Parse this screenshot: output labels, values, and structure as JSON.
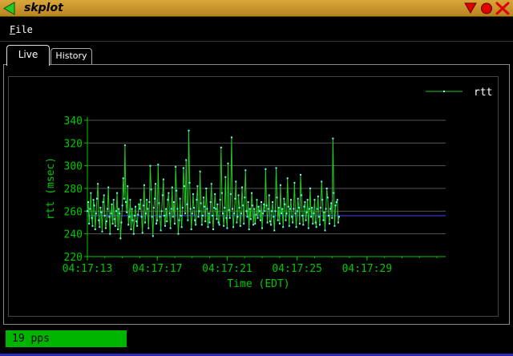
{
  "window": {
    "title": "skplot"
  },
  "menu": {
    "file_label": "File",
    "file_mnemonic": "F",
    "file_rest": "ile"
  },
  "tabs": [
    {
      "label": "Live",
      "active": true
    },
    {
      "label": "History",
      "active": false
    }
  ],
  "status": {
    "rate": "19 pps"
  },
  "colors": {
    "line": "#22cc22",
    "marker": "#66ffff",
    "mean": "#4444ff",
    "axis": "#00c800",
    "grid": "#555555",
    "titlebar": "#c8962c",
    "status": "#00b400"
  },
  "chart_data": {
    "type": "line",
    "xlabel": "Time (EDT)",
    "ylabel": "rtt (msec)",
    "ylim": [
      220,
      340
    ],
    "yticks": [
      220,
      240,
      260,
      280,
      300,
      320,
      340
    ],
    "xticks": [
      "04:17:13",
      "04:17:17",
      "04:17:21",
      "04:17:25",
      "04:17:29"
    ],
    "xlim_seconds": [
      13,
      33.5
    ],
    "mean_line": 256,
    "grid": true,
    "legend": {
      "position": "top-right",
      "entries": [
        "rtt"
      ]
    },
    "series": [
      {
        "name": "rtt",
        "x_step_seconds": 0.05,
        "x_start_seconds": 13,
        "values": [
          260,
          268,
          249,
          262,
          276,
          254,
          247,
          270,
          265,
          244,
          258,
          271,
          284,
          252,
          246,
          263,
          259,
          242,
          268,
          274,
          256,
          245,
          251,
          262,
          281,
          255,
          240,
          258,
          266,
          249,
          270,
          253,
          247,
          260,
          276,
          244,
          262,
          258,
          236,
          250,
          265,
          289,
          271,
          318,
          268,
          259,
          282,
          248,
          255,
          270,
          244,
          262,
          252,
          240,
          256,
          264,
          251,
          247,
          257,
          266,
          262,
          270,
          255,
          241,
          265,
          283,
          250,
          258,
          270,
          262,
          245,
          268,
          300,
          279,
          255,
          238,
          263,
          271,
          284,
          249,
          252,
          301,
          267,
          255,
          243,
          260,
          274,
          288,
          256,
          247,
          262,
          251,
          270,
          276,
          258,
          245,
          262,
          281,
          255,
          268,
          249,
          299,
          278,
          262,
          240,
          252,
          271,
          256,
          246,
          263,
          298,
          282,
          258,
          305,
          266,
          252,
          331,
          285,
          262,
          244,
          258,
          275,
          263,
          252,
          248,
          270,
          282,
          255,
          260,
          295,
          267,
          248,
          256,
          272,
          264,
          251,
          280,
          262,
          246,
          258,
          250,
          268,
          284,
          256,
          244,
          263,
          275,
          262,
          253,
          266,
          250,
          248,
          270,
          316,
          276,
          258,
          247,
          263,
          290,
          254,
          245,
          302,
          261,
          254,
          275,
          325,
          262,
          246,
          258,
          271,
          286,
          250,
          255,
          274,
          263,
          247,
          258,
          281,
          265,
          249,
          272,
          296,
          260,
          255,
          268,
          244,
          262,
          253,
          276,
          265,
          248,
          262,
          249,
          257,
          270,
          254,
          264,
          260,
          252,
          268,
          245,
          258,
          266,
          260,
          297,
          265,
          250,
          262,
          274,
          251,
          248,
          260,
          268,
          255,
          243,
          260,
          298,
          272,
          252,
          263,
          249,
          283,
          258,
          262,
          246,
          271,
          266,
          252,
          258,
          289,
          264,
          247,
          262,
          270,
          255,
          250,
          262,
          285,
          258,
          246,
          260,
          271,
          263,
          249,
          292,
          274,
          256,
          248,
          264,
          268,
          252,
          259,
          270,
          245,
          262,
          280,
          255,
          263,
          249,
          258,
          270,
          250,
          246,
          262,
          273,
          255,
          248,
          263,
          286,
          270,
          252,
          259,
          243,
          262,
          280,
          272,
          256,
          249,
          262,
          267,
          254,
          324,
          276,
          247,
          265,
          268,
          270,
          250,
          255
        ]
      }
    ]
  }
}
